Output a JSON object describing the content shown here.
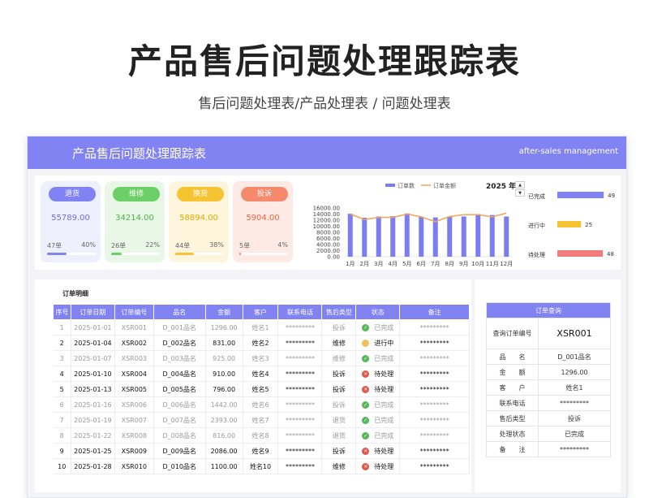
{
  "page": {
    "title": "产品售后问题处理跟踪表",
    "subtitle": "售后问题处理表/产品处理表 / 问题处理表"
  },
  "banner": {
    "title": "产品售后问题处理跟踪表",
    "subtitle_en": "after-sales management"
  },
  "cards": [
    {
      "label": "退货",
      "amount": "55789.00",
      "count": "47单",
      "percent": "40%",
      "progress": 0.4,
      "pill": "#8283f3",
      "bg": "#eef0fd",
      "text": "#6a6ee6",
      "bar": "#8283f3"
    },
    {
      "label": "维修",
      "amount": "34214.00",
      "count": "26单",
      "percent": "22%",
      "progress": 0.22,
      "pill": "#6ccf68",
      "bg": "#e8f7e6",
      "text": "#4bb24a",
      "bar": "#6ccf68"
    },
    {
      "label": "换货",
      "amount": "58894.00",
      "count": "44单",
      "percent": "38%",
      "progress": 0.38,
      "pill": "#f6c432",
      "bg": "#fdf6dc",
      "text": "#e0a800",
      "bar": "#f6c432"
    },
    {
      "label": "投诉",
      "amount": "5904.00",
      "count": "5单",
      "percent": "4%",
      "progress": 0.04,
      "pill": "#f5896c",
      "bg": "#fdeae4",
      "text": "#e8643f",
      "bar": "#f5896c"
    }
  ],
  "chart_data": [
    {
      "type": "bar",
      "year_label": "2025 年",
      "legend": [
        "订单数",
        "订单金额"
      ],
      "categories": [
        "1月",
        "2月",
        "3月",
        "4月",
        "5月",
        "6月",
        "7月",
        "8月",
        "9月",
        "10月",
        "11月",
        "12月"
      ],
      "y_ticks": [
        "16000.00",
        "14000.00",
        "12000.00",
        "10000.00",
        "8000.00",
        "6000.00",
        "4000.00",
        "2000.00",
        "0.00"
      ],
      "ylim": [
        0,
        16000
      ],
      "series": [
        {
          "name": "订单数",
          "type": "bar",
          "color": "#7b7ef0",
          "values": [
            14100,
            12800,
            13200,
            13300,
            14200,
            13100,
            12900,
            13200,
            13200,
            14000,
            13700,
            13200
          ]
        },
        {
          "name": "订单金额",
          "type": "line",
          "color": "#f0a35a",
          "values": [
            14000,
            12200,
            12900,
            12900,
            14000,
            13100,
            11500,
            13200,
            13800,
            13800,
            13100,
            14300
          ]
        }
      ]
    },
    {
      "type": "bar",
      "orientation": "horizontal",
      "categories": [
        "已完成",
        "进行中",
        "待处理"
      ],
      "values": [
        49,
        25,
        48
      ],
      "colors": [
        "#8283f3",
        "#f6c432",
        "#f27b7b"
      ],
      "xlim": [
        0,
        60
      ]
    }
  ],
  "orders": {
    "section_title": "订单明细",
    "columns": [
      "序号",
      "订单日期",
      "订单编号",
      "品名",
      "金额",
      "客户",
      "联系电话",
      "售后类型",
      "状态",
      "备注"
    ],
    "rows": [
      [
        "1",
        "2025-01-01",
        "XSR001",
        "D_001品名",
        "1296.00",
        "姓名1",
        "*********",
        "投诉",
        "已完成",
        "*********"
      ],
      [
        "2",
        "2025-01-04",
        "XSR002",
        "D_002品名",
        "831.00",
        "姓名2",
        "*********",
        "维修",
        "进行中",
        "*********"
      ],
      [
        "3",
        "2025-01-07",
        "XSR003",
        "D_003品名",
        "925.00",
        "姓名3",
        "*********",
        "维修",
        "已完成",
        "*********"
      ],
      [
        "4",
        "2025-01-10",
        "XSR004",
        "D_004品名",
        "910.00",
        "姓名4",
        "*********",
        "投诉",
        "待处理",
        "*********"
      ],
      [
        "5",
        "2025-01-13",
        "XSR005",
        "D_005品名",
        "796.00",
        "姓名5",
        "*********",
        "投诉",
        "待处理",
        "*********"
      ],
      [
        "6",
        "2025-01-16",
        "XSR006",
        "D_006品名",
        "1442.00",
        "姓名6",
        "*********",
        "投诉",
        "已完成",
        "*********"
      ],
      [
        "7",
        "2025-01-19",
        "XSR007",
        "D_007品名",
        "2393.00",
        "姓名7",
        "*********",
        "退货",
        "已完成",
        "*********"
      ],
      [
        "8",
        "2025-01-22",
        "XSR008",
        "D_008品名",
        "816.00",
        "姓名8",
        "*********",
        "退货",
        "已完成",
        "*********"
      ],
      [
        "9",
        "2025-01-25",
        "XSR009",
        "D_009品名",
        "2086.00",
        "姓名9",
        "*********",
        "投诉",
        "待处理",
        "*********"
      ],
      [
        "10",
        "2025-01-28",
        "XSR010",
        "D_010品名",
        "1100.00",
        "姓名10",
        "*********",
        "维修",
        "待处理",
        "*********"
      ]
    ],
    "status_colors": {
      "已完成": "#55b85a",
      "进行中": "#f0c060",
      "待处理": "#e2564a"
    }
  },
  "query": {
    "title": "订单查询",
    "lookup_label": "查询订单编号",
    "lookup_value": "XSR001",
    "fields": [
      {
        "label": "品　　名",
        "value": "D_001品名"
      },
      {
        "label": "金　　额",
        "value": "1296.00"
      },
      {
        "label": "客　　户",
        "value": "姓名1"
      },
      {
        "label": "联系电话",
        "value": "*********"
      },
      {
        "label": "售后类型",
        "value": "投诉"
      },
      {
        "label": "处理状态",
        "value": "已完成"
      },
      {
        "label": "备　　注",
        "value": "*********"
      }
    ]
  }
}
